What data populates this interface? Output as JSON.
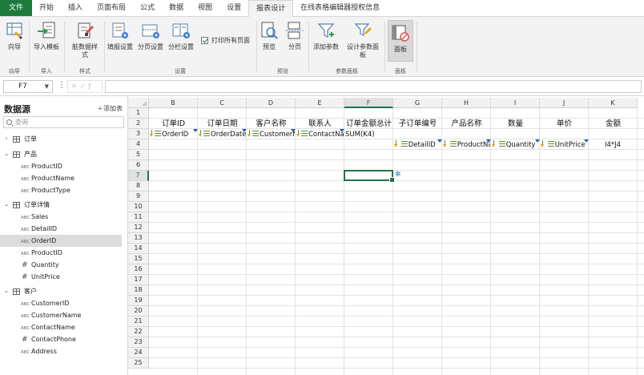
{
  "tabs": [
    {
      "label": "文件"
    },
    {
      "label": "开始"
    },
    {
      "label": "插入"
    },
    {
      "label": "页面布局"
    },
    {
      "label": "公式"
    },
    {
      "label": "数据"
    },
    {
      "label": "视图"
    },
    {
      "label": "设置"
    },
    {
      "label": "报表设计"
    },
    {
      "label": "在线表格编辑器授权信息"
    }
  ],
  "ribbon": {
    "buttons": {
      "wizard": "向导",
      "import_template": "导入模板",
      "dirty_style": "脏数据样式",
      "fill_settings": "填报设置",
      "page_settings": "分页设置",
      "column_settings": "分栏设置",
      "print_all_pages": "打印所有页面",
      "preview": "预览",
      "paginate": "分页",
      "add_param": "添加参数",
      "design_param_panel": "设计参数面板",
      "panel": "面板"
    },
    "groups": {
      "wizard": "向导",
      "import": "导入",
      "style": "样式",
      "settings": "设置",
      "preview": "预览",
      "param_panel": "参数面板",
      "panel": "面板"
    }
  },
  "formula_bar": {
    "cell_ref": "F7",
    "formula": ""
  },
  "datasource": {
    "title": "数据源",
    "add_table": "添加表",
    "search_placeholder": "查询",
    "tables": [
      {
        "name": "订单",
        "expanded": false,
        "fields": []
      },
      {
        "name": "产品",
        "expanded": true,
        "fields": [
          {
            "type": "ABC",
            "name": "ProductID"
          },
          {
            "type": "ABC",
            "name": "ProductName"
          },
          {
            "type": "ABC",
            "name": "ProductType"
          }
        ]
      },
      {
        "name": "订单详情",
        "expanded": true,
        "fields": [
          {
            "type": "ABC",
            "name": "Sales"
          },
          {
            "type": "ABC",
            "name": "DetailID"
          },
          {
            "type": "ABC",
            "name": "OrderID",
            "selected": true
          },
          {
            "type": "ABC",
            "name": "ProductID"
          },
          {
            "type": "#",
            "name": "Quantity"
          },
          {
            "type": "#",
            "name": "UnitPrice"
          }
        ]
      },
      {
        "name": "客户",
        "expanded": true,
        "fields": [
          {
            "type": "ABC",
            "name": "CustomerID"
          },
          {
            "type": "ABC",
            "name": "CustomerName"
          },
          {
            "type": "ABC",
            "name": "ContactName"
          },
          {
            "type": "#",
            "name": "ContactPhone"
          },
          {
            "type": "ABC",
            "name": "Address"
          }
        ]
      }
    ]
  },
  "grid": {
    "columns": [
      "B",
      "C",
      "D",
      "E",
      "F",
      "G",
      "H",
      "I",
      "J",
      "K"
    ],
    "active_column": "F",
    "rows": [
      "1",
      "2",
      "3",
      "4",
      "5",
      "6",
      "7",
      "8",
      "9",
      "10",
      "11",
      "12",
      "13",
      "14",
      "15",
      "16",
      "17",
      "18",
      "19",
      "20",
      "21",
      "22",
      "23",
      "24",
      "25"
    ],
    "active_row": "7",
    "row2_headers": [
      "订单ID",
      "订单日期",
      "客户名称",
      "联系人",
      "订单金额总计",
      "子订单编号",
      "产品名称",
      "数量",
      "单价",
      "金额"
    ],
    "row3": {
      "B": "OrderID",
      "C": "OrderDate",
      "D": "CustomerName",
      "E": "ContactName",
      "F": "SUM(K4)"
    },
    "row4": {
      "G": "DetailID",
      "H": "ProductName",
      "I": "Quantity",
      "J": "UnitPrice",
      "K": "I4*J4"
    }
  }
}
